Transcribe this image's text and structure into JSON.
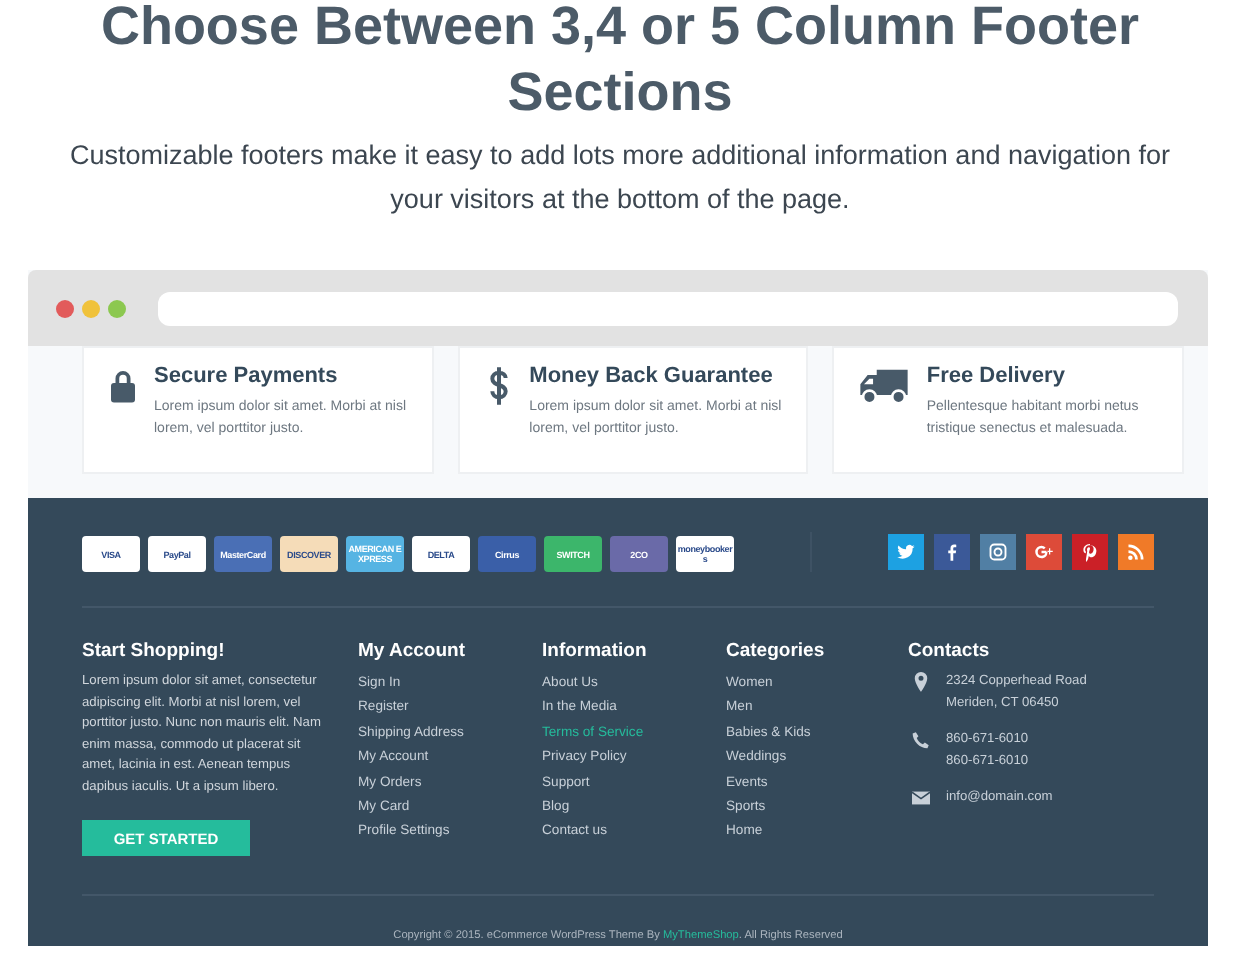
{
  "heading": "Choose Between 3,4 or 5 Column Footer Sections",
  "subheading": "Customizable footers make it easy to add lots more additional information and navigation for your visitors at the bottom of the page.",
  "features": [
    {
      "kind": "lock",
      "title": "Secure Payments",
      "text": "Lorem ipsum dolor sit amet. Morbi at nisl lorem, vel porttitor justo."
    },
    {
      "kind": "dollar",
      "title": "Money Back Guarantee",
      "text": "Lorem ipsum dolor sit amet. Morbi at nisl lorem, vel porttitor justo."
    },
    {
      "kind": "truck",
      "title": "Free Delivery",
      "text": "Pellentesque habitant morbi netus tristique senectus et malesuada."
    }
  ],
  "payment_cards": [
    {
      "label": "VISA",
      "color": "#ffffff"
    },
    {
      "label": "PayPal",
      "color": "#ffffff"
    },
    {
      "label": "MasterCard",
      "color": "#4a6fb5"
    },
    {
      "label": "DISCOVER",
      "color": "#f5dcb8"
    },
    {
      "label": "AMERICAN EXPRESS",
      "color": "#56b4e3"
    },
    {
      "label": "DELTA",
      "color": "#ffffff"
    },
    {
      "label": "Cirrus",
      "color": "#3a5fa8"
    },
    {
      "label": "SWITCH",
      "color": "#3cb66b"
    },
    {
      "label": "2CO",
      "color": "#6a6aa8"
    },
    {
      "label": "moneybookers",
      "color": "#ffffff"
    }
  ],
  "social": [
    {
      "kind": "twitter",
      "color": "#1da1e2"
    },
    {
      "kind": "facebook",
      "color": "#3b5998"
    },
    {
      "kind": "instagram",
      "color": "#517fa4"
    },
    {
      "kind": "googleplus",
      "color": "#dd4b39"
    },
    {
      "kind": "pinterest",
      "color": "#cb2027"
    },
    {
      "kind": "rss",
      "color": "#f07a28"
    }
  ],
  "intro": {
    "title": "Start Shopping!",
    "text": "Lorem ipsum dolor sit amet, consectetur adipiscing elit. Morbi at nisl lorem, vel porttitor justo. Nunc non mauris elit. Nam enim massa, commodo ut placerat sit amet, lacinia in est. Aenean tempus dapibus iaculis. Ut a ipsum libero.",
    "button": "GET STARTED"
  },
  "link_columns": [
    {
      "title": "My Account",
      "links": [
        {
          "label": "Sign In",
          "selected": false
        },
        {
          "label": "Register",
          "selected": false
        },
        {
          "label": "Shipping Address",
          "selected": false
        },
        {
          "label": "My Account",
          "selected": false
        },
        {
          "label": "My Orders",
          "selected": false
        },
        {
          "label": "My Card",
          "selected": false
        },
        {
          "label": "Profile Settings",
          "selected": false
        }
      ]
    },
    {
      "title": "Information",
      "links": [
        {
          "label": "About Us",
          "selected": false
        },
        {
          "label": "In the Media",
          "selected": false
        },
        {
          "label": "Terms of Service",
          "selected": true
        },
        {
          "label": "Privacy Policy",
          "selected": false
        },
        {
          "label": "Support",
          "selected": false
        },
        {
          "label": "Blog",
          "selected": false
        },
        {
          "label": "Contact us",
          "selected": false
        }
      ]
    },
    {
      "title": "Categories",
      "links": [
        {
          "label": "Women",
          "selected": false
        },
        {
          "label": "Men",
          "selected": false
        },
        {
          "label": "Babies & Kids",
          "selected": false
        },
        {
          "label": "Weddings",
          "selected": false
        },
        {
          "label": "Events",
          "selected": false
        },
        {
          "label": "Sports",
          "selected": false
        },
        {
          "label": "Home",
          "selected": false
        }
      ]
    }
  ],
  "contacts": {
    "title": "Contacts",
    "items": [
      {
        "kind": "location",
        "lines": [
          "2324 Copperhead Road",
          "Meriden, CT 06450"
        ]
      },
      {
        "kind": "phone",
        "lines": [
          "860-671-6010",
          "860-671-6010"
        ]
      },
      {
        "kind": "email",
        "lines": [
          "info@domain.com"
        ]
      }
    ]
  },
  "copyright": {
    "text": "Copyright © 2015. eCommerce  WordPress Theme By",
    "link": "MyThemeShop",
    "suffix": ". All Rights Reserved"
  }
}
